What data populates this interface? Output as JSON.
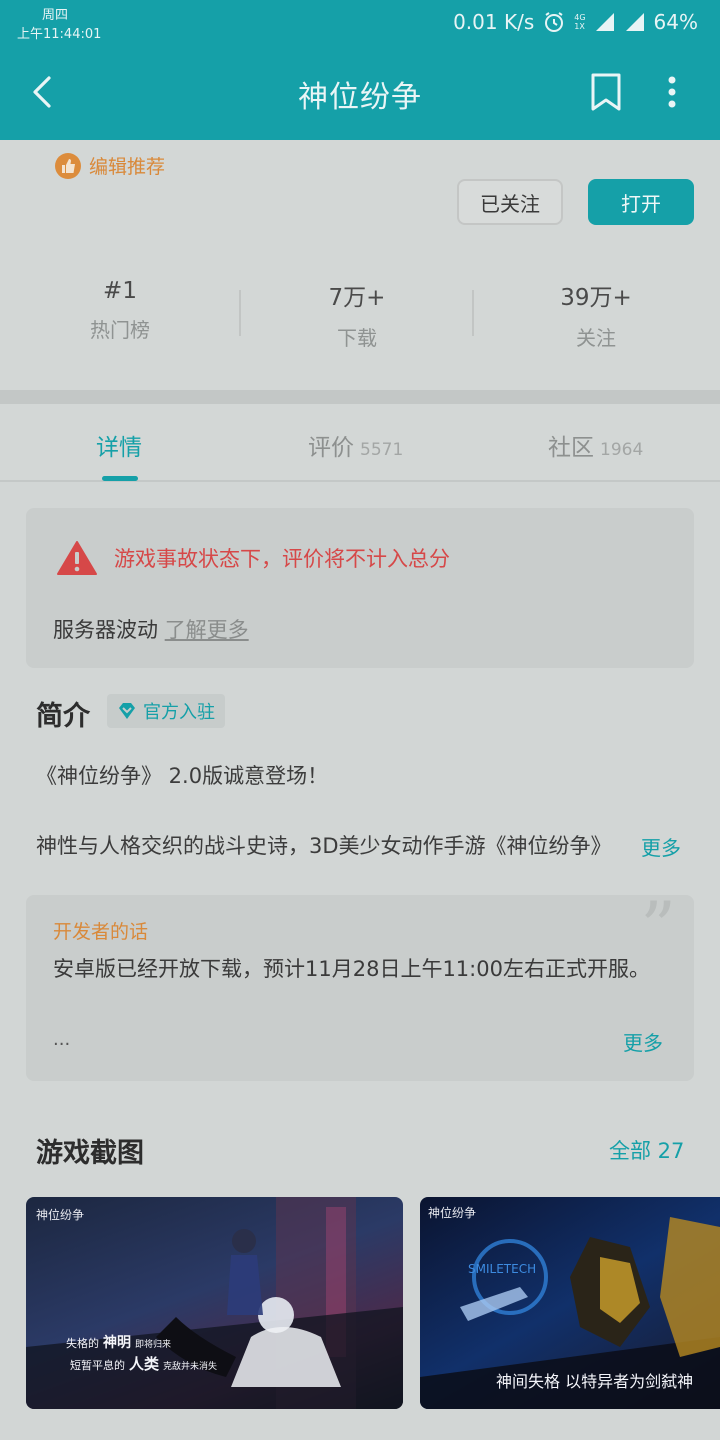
{
  "status_bar": {
    "weekday": "周四",
    "time": "上午11:44:01",
    "net_speed": "0.01 K/s",
    "net_type_top": "4G",
    "net_type_bottom": "1X",
    "battery": "64%"
  },
  "appbar": {
    "title": "神位纷争"
  },
  "header": {
    "editor_badge": "编辑推荐",
    "follow_label": "已关注",
    "open_label": "打开",
    "stats": [
      {
        "value": "#1",
        "label": "热门榜"
      },
      {
        "value": "7万+",
        "label": "下载"
      },
      {
        "value": "39万+",
        "label": "关注"
      }
    ]
  },
  "tabs": [
    {
      "label": "详情",
      "count": ""
    },
    {
      "label": "评价",
      "count": "5571"
    },
    {
      "label": "社区",
      "count": "1964"
    }
  ],
  "notice": {
    "warning": "游戏事故状态下，评价将不计入总分",
    "reason": "服务器波动",
    "link": "了解更多"
  },
  "intro": {
    "title": "简介",
    "official_badge": "官方入驻",
    "line1": "《神位纷争》 2.0版诚意登场！",
    "line2": "神性与人格交织的战斗史诗，3D美少女动作手游《神位纷争》",
    "more": "更多"
  },
  "developer_note": {
    "label": "开发者的话",
    "text": "安卓版已经开放下载，预计11月28日上午11:00左右正式开服。",
    "ellipsis": "...",
    "more": "更多"
  },
  "screenshots": {
    "title": "游戏截图",
    "all_label": "全部 27",
    "shot1": {
      "logo": "神位纷争",
      "caption1a": "失格的",
      "caption1b": "神明",
      "caption1c": "即将归来",
      "caption2a": "短暂平息的",
      "caption2b": "人类",
      "caption2c": "克敌并未消失"
    },
    "shot2": {
      "logo": "神位纷争",
      "sign": "SMILETECH",
      "caption": "神间失格 以特异者为剑弑神"
    }
  },
  "colors": {
    "accent": "#15a0a8",
    "warning": "#d64848",
    "highlight": "#d9893a"
  }
}
